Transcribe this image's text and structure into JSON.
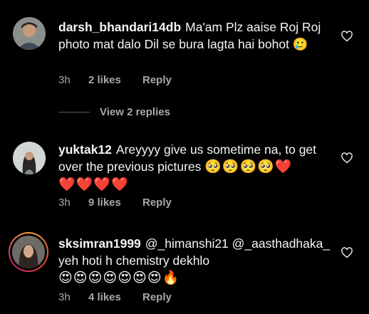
{
  "comments": [
    {
      "username": "darsh_bhandari14db",
      "text": "Ma'am Plz aaise Roj Roj photo mat dalo Dil se bura lagta hai bohot",
      "emoji": "🥲",
      "time": "3h",
      "likes": "2 likes",
      "reply": "Reply"
    },
    {
      "username": "yuktak12",
      "text": "Areyyyy give us sometime na, to get over the previous pictures",
      "emoji": "🥺🥺🥺🥺❤️",
      "emoji2": "❤️❤️❤️❤️",
      "time": "3h",
      "likes": "9 likes",
      "reply": "Reply"
    },
    {
      "username": "sksimran1999",
      "text": "@_himanshi21 @_aasthadhaka_ yeh hoti h chemistry  dekhlo",
      "emoji": "😍😍😍😍😍😍😍🔥",
      "time": "3h",
      "likes": "4 likes",
      "reply": "Reply"
    }
  ],
  "view_replies": "View 2 replies",
  "icons": {
    "like": "heart-outline-icon",
    "avatar": "avatar-photo"
  },
  "colors": {
    "background": "#000000",
    "text": "#f5f5f5",
    "secondary": "#a8a8a8"
  }
}
